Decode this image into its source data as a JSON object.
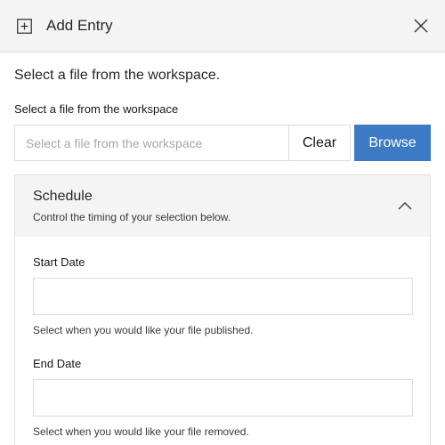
{
  "dialog": {
    "title": "Add Entry",
    "header_icon": "add-box-icon",
    "close_icon": "close-icon"
  },
  "intro": "Select a file from the workspace.",
  "file_field": {
    "label": "Select a file from the workspace",
    "placeholder": "Select a file from the workspace",
    "value": "",
    "clear_label": "Clear",
    "browse_label": "Browse"
  },
  "schedule": {
    "title": "Schedule",
    "description": "Control the timing of your selection below.",
    "expanded": true,
    "chevron_icon": "chevron-up-icon",
    "start": {
      "label": "Start Date",
      "value": "",
      "helper": "Select when you would like your file published."
    },
    "end": {
      "label": "End Date",
      "value": "",
      "helper": "Select when you would like your file removed."
    }
  },
  "colors": {
    "accent": "#3c7bc4",
    "header_bg": "#f4f4f4",
    "border": "#dcdcdc"
  }
}
